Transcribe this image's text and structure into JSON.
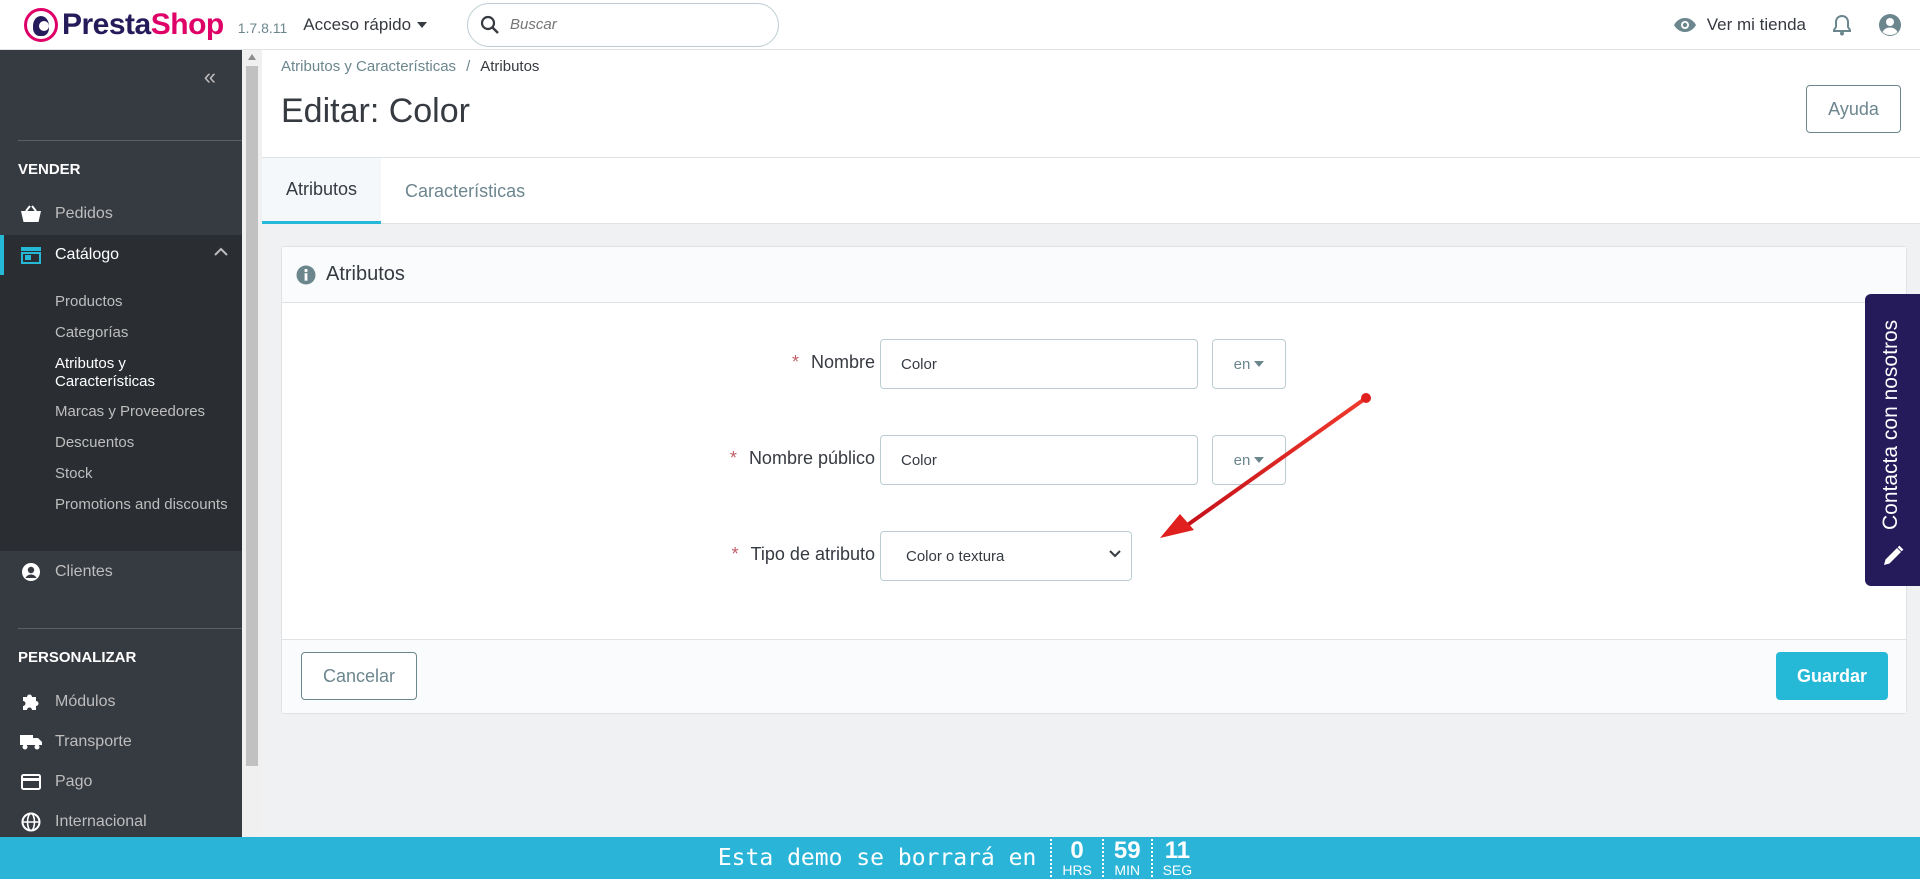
{
  "header": {
    "logo_part1": "Presta",
    "logo_part2": "Shop",
    "version": "1.7.8.11",
    "quick_access": "Acceso rápido",
    "search_placeholder": "Buscar",
    "view_store": "Ver mi tienda"
  },
  "sidebar": {
    "section_sell": "VENDER",
    "orders": "Pedidos",
    "catalog": "Catálogo",
    "catalog_sub": [
      "Productos",
      "Categorías",
      "Atributos y Características",
      "Marcas y Proveedores",
      "Descuentos",
      "Stock",
      "Promotions and discounts"
    ],
    "customers": "Clientes",
    "section_customize": "PERSONALIZAR",
    "modules": "Módulos",
    "shipping": "Transporte",
    "payment": "Pago",
    "international": "Internacional"
  },
  "breadcrumb": {
    "parent": "Atributos y Características",
    "current": "Atributos"
  },
  "page": {
    "title": "Editar: Color",
    "help": "Ayuda"
  },
  "tabs": [
    "Atributos",
    "Características"
  ],
  "form": {
    "card_title": "Atributos",
    "name_label": "Nombre",
    "name_value": "Color",
    "public_name_label": "Nombre público",
    "public_name_value": "Color",
    "lang": "en",
    "type_label": "Tipo de atributo",
    "type_value": "Color o textura",
    "required_mark": "*",
    "cancel": "Cancelar",
    "save": "Guardar"
  },
  "contact": "Contacta con nosotros",
  "demo": {
    "message": "Esta demo se borrará en",
    "hours": "0",
    "hours_unit": "HRS",
    "minutes": "59",
    "minutes_unit": "MIN",
    "seconds": "11",
    "seconds_unit": "SEG"
  },
  "colors": {
    "accent": "#25b9d7",
    "sidebar": "#363a41",
    "brand": "#251b5b",
    "arrow": "#e0201e"
  }
}
